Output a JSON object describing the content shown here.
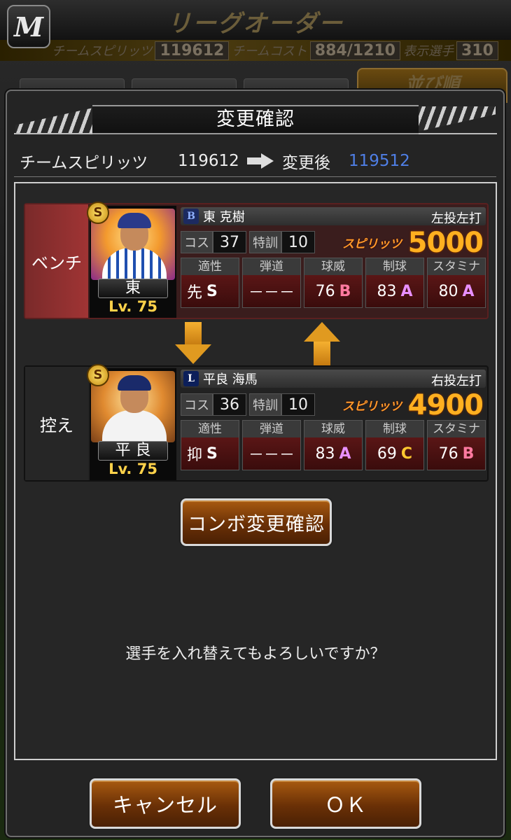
{
  "app_logo": "M",
  "screen_title": "リーグオーダー",
  "stats_bar": {
    "spirits_label": "チームスピリッツ",
    "spirits_value": "119612",
    "cost_label": "チームコスト",
    "cost_value": "884/1210",
    "display_label": "表示選手",
    "display_value": "310"
  },
  "sort_tab": "並び順",
  "dialog": {
    "title": "変更確認",
    "spirits_label": "チームスピリッツ",
    "spirits_before": "119612",
    "after_label": "変更後",
    "spirits_after": "119512",
    "question": "選手を入れ替えてもよろしいですか？",
    "combo_button": "コンボ変更確認",
    "cancel_button": "キャンセル",
    "ok_button": "ＯＫ"
  },
  "labels": {
    "cost": "コス",
    "training": "特訓",
    "spirits": "スピリッツ",
    "aptitude": "適性",
    "trajectory": "弾道",
    "velocity": "球威",
    "control": "制球",
    "stamina": "スタミナ"
  },
  "players": [
    {
      "role": "ベンチ",
      "rank_badge": "S",
      "card_name": "東",
      "level": "Lv. 75",
      "team_mark": "B",
      "full_name": "東 克樹",
      "handedness": "左投左打",
      "cost": "37",
      "training": "10",
      "spirits": "5000",
      "aptitude": "先",
      "aptitude_grade": "S",
      "trajectory": "－－－",
      "velocity": "76",
      "velocity_grade": "B",
      "control": "83",
      "control_grade": "A",
      "stamina": "80",
      "stamina_grade": "A"
    },
    {
      "role": "控え",
      "rank_badge": "S",
      "card_name": "平 良",
      "level": "Lv. 75",
      "team_mark": "L",
      "full_name": "平良 海馬",
      "handedness": "右投左打",
      "cost": "36",
      "training": "10",
      "spirits": "4900",
      "aptitude": "抑",
      "aptitude_grade": "S",
      "trajectory": "－－－",
      "velocity": "83",
      "velocity_grade": "A",
      "control": "69",
      "control_grade": "C",
      "stamina": "76",
      "stamina_grade": "B"
    }
  ]
}
